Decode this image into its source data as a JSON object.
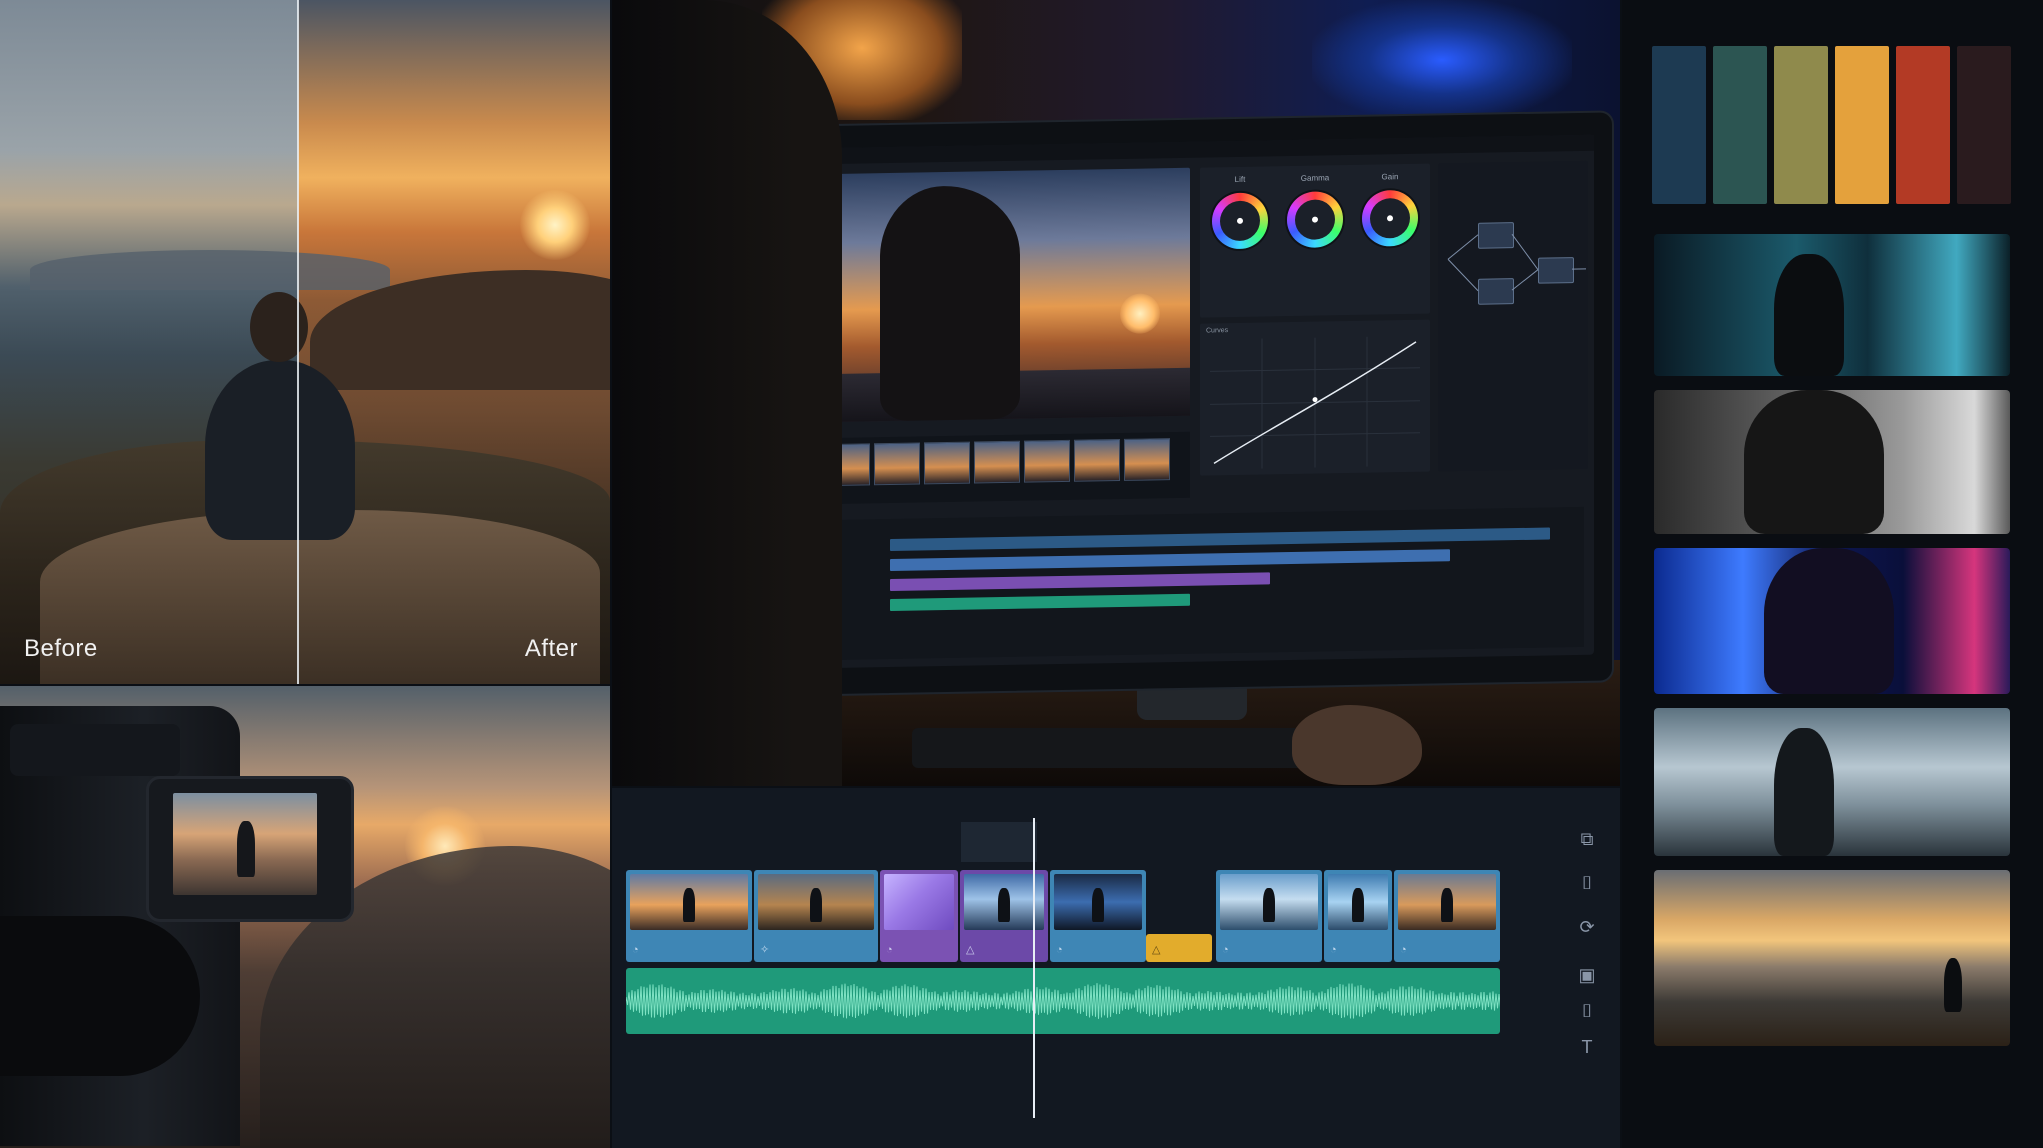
{
  "before_after": {
    "before_label": "Before",
    "after_label": "After"
  },
  "editor": {
    "app_title": "≡ ··· ···",
    "curves_title": "Curves",
    "wheel_labels": [
      "Lift",
      "Gamma",
      "Gain"
    ]
  },
  "timeline": {
    "clip_icons": [
      "◔",
      "✧",
      "◔",
      "△",
      "◔",
      "◔",
      "△",
      "◔",
      "◔",
      "◔"
    ],
    "tool_icons": [
      "⧉",
      "⌷",
      "⟳",
      "▣",
      "⌷",
      "T"
    ]
  },
  "palette": {
    "swatches": [
      "#1d3a52",
      "#2c5552",
      "#8f8a4c",
      "#e4a13c",
      "#b33a25",
      "#2a1b1e"
    ]
  },
  "colors": {
    "audio_green": "#1f9a7a",
    "clip_blue": "#3e86b5",
    "clip_purple": "#7b52b3",
    "clip_yellow": "#e2ac2c"
  }
}
